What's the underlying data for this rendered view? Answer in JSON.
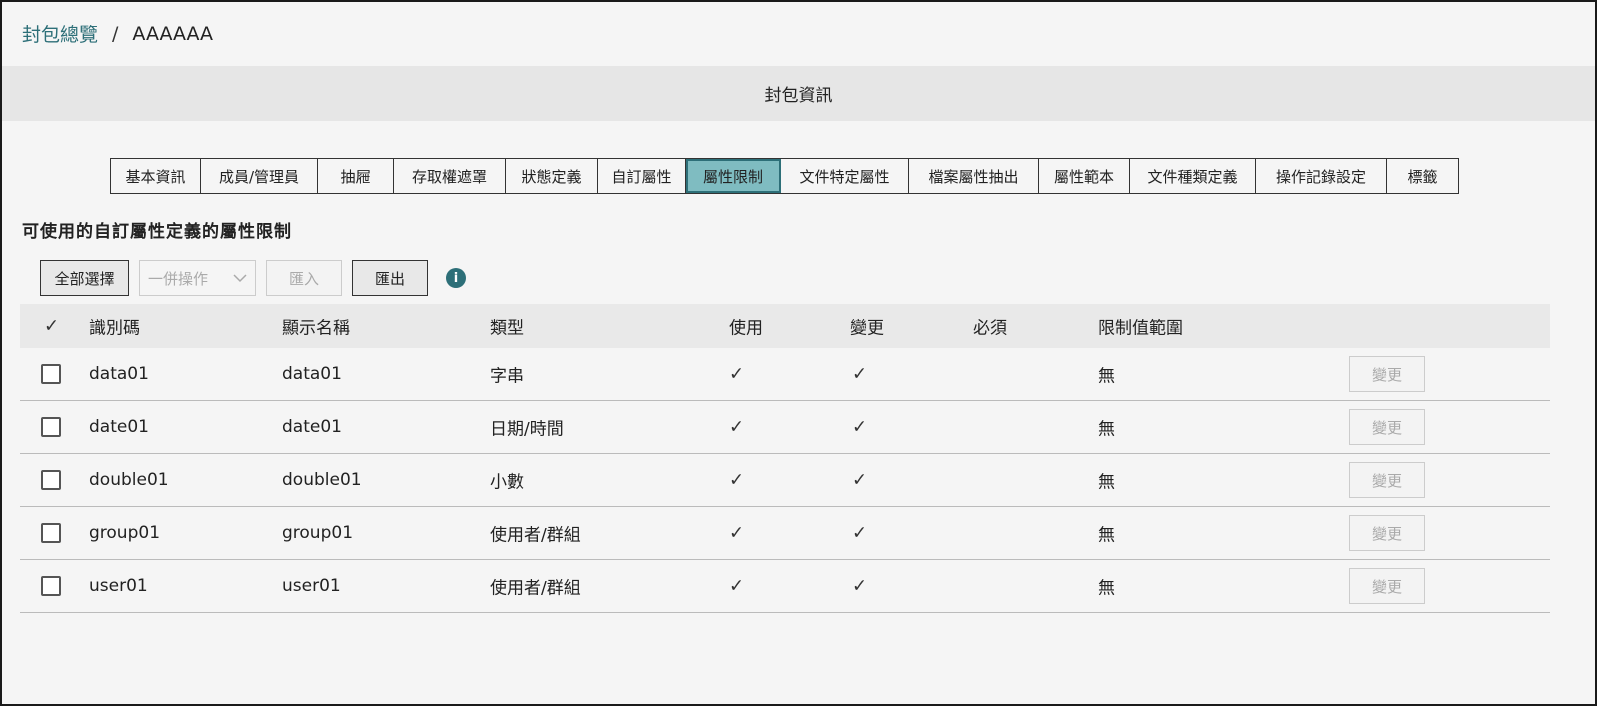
{
  "breadcrumb": {
    "parent": "封包總覽",
    "separator": "/",
    "current": "AAAAAA"
  },
  "section_title": "封包資訊",
  "tabs": [
    {
      "label": "基本資訊"
    },
    {
      "label": "成員/管理員"
    },
    {
      "label": "抽屜"
    },
    {
      "label": "存取權遮罩"
    },
    {
      "label": "狀態定義"
    },
    {
      "label": "自訂屬性"
    },
    {
      "label": "屬性限制"
    },
    {
      "label": "文件特定屬性"
    },
    {
      "label": "檔案屬性抽出"
    },
    {
      "label": "屬性範本"
    },
    {
      "label": "文件種類定義"
    },
    {
      "label": "操作記錄設定"
    },
    {
      "label": "標籤"
    }
  ],
  "active_tab": "屬性限制",
  "heading": "可使用的自訂屬性定義的屬性限制",
  "toolbar": {
    "select_all": "全部選擇",
    "bulk_action": "一併操作",
    "import": "匯入",
    "export": "匯出",
    "info_icon": "i"
  },
  "table": {
    "headers": {
      "check": "✓",
      "id": "識別碼",
      "display_name": "顯示名稱",
      "type": "類型",
      "use": "使用",
      "change": "變更",
      "required": "必須",
      "range": "限制值範圍"
    },
    "rows": [
      {
        "id": "data01",
        "display_name": "data01",
        "type": "字串",
        "use": "✓",
        "change": "✓",
        "required": "",
        "range": "無",
        "action": "變更"
      },
      {
        "id": "date01",
        "display_name": "date01",
        "type": "日期/時間",
        "use": "✓",
        "change": "✓",
        "required": "",
        "range": "無",
        "action": "變更"
      },
      {
        "id": "double01",
        "display_name": "double01",
        "type": "小數",
        "use": "✓",
        "change": "✓",
        "required": "",
        "range": "無",
        "action": "變更"
      },
      {
        "id": "group01",
        "display_name": "group01",
        "type": "使用者/群組",
        "use": "✓",
        "change": "✓",
        "required": "",
        "range": "無",
        "action": "變更"
      },
      {
        "id": "user01",
        "display_name": "user01",
        "type": "使用者/群組",
        "use": "✓",
        "change": "✓",
        "required": "",
        "range": "無",
        "action": "變更"
      }
    ]
  },
  "colors": {
    "accent": "#2d6f78",
    "active_tab": "#7fbcc1",
    "header_bg": "#e6e6e6"
  }
}
